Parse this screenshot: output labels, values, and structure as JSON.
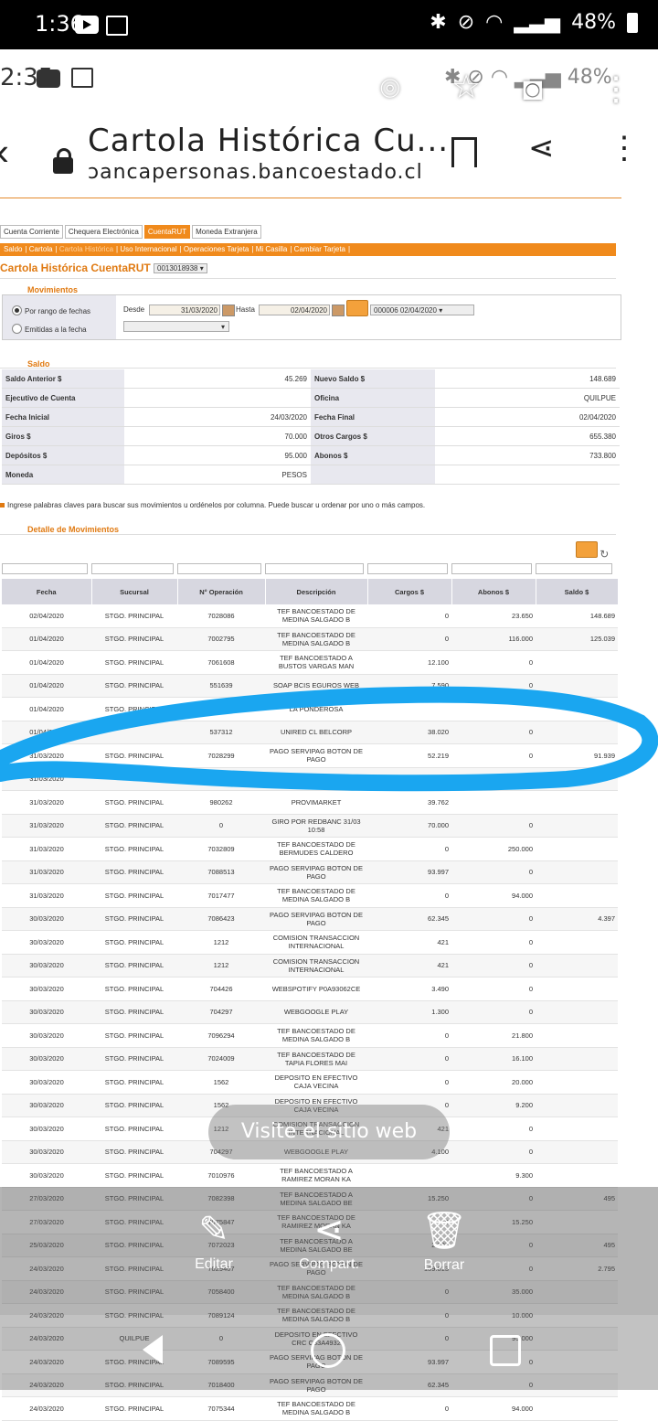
{
  "status_bar": {
    "time": "1:36",
    "battery": "48%"
  },
  "inner_status": {
    "time": "2:35",
    "battery": "48%"
  },
  "browser": {
    "title": "Cartola Histórica Cu...",
    "url": "bancapersonas.bancoestado.cl",
    "url_shown": "ɔancapersonas.bancoestado.cl"
  },
  "tabs": [
    "Cuenta Corriente",
    "Chequera Electrónica",
    "CuentaRUT",
    "Moneda Extranjera"
  ],
  "subnav": [
    "Saldo",
    "Cartola",
    "Cartola Histórica",
    "Uso Internacional",
    "Operaciones Tarjeta",
    "Mi Casilla",
    "Cambiar Tarjeta"
  ],
  "page_title": "Cartola Histórica CuentaRUT N°",
  "account_number": "0013018938",
  "movimientos": {
    "section": "Movimientos",
    "option_range": "Por rango de fechas",
    "option_emitidas": "Emitidas a la fecha",
    "desde_label": "Desde",
    "desde_value": "31/03/2020",
    "hasta_label": "Hasta",
    "hasta_value": "02/04/2020",
    "statement_select": "000006 02/04/2020"
  },
  "saldo": {
    "section": "Saldo",
    "rows": [
      {
        "l1": "Saldo Anterior $",
        "v1": "45.269",
        "l2": "Nuevo Saldo $",
        "v2": "148.689"
      },
      {
        "l1": "Ejecutivo de Cuenta",
        "v1": "",
        "l2": "Oficina",
        "v2": "QUILPUE"
      },
      {
        "l1": "Fecha Inicial",
        "v1": "24/03/2020",
        "l2": "Fecha Final",
        "v2": "02/04/2020"
      },
      {
        "l1": "Giros $",
        "v1": "70.000",
        "l2": "Otros Cargos $",
        "v2": "655.380"
      },
      {
        "l1": "Depósitos $",
        "v1": "95.000",
        "l2": "Abonos $",
        "v2": "733.800"
      },
      {
        "l1": "Moneda",
        "v1": "PESOS",
        "l2": "",
        "v2": ""
      }
    ]
  },
  "hint": "Ingrese palabras claves para buscar sus movimientos u ordénelos por columna. Puede buscar u ordenar por uno o más campos.",
  "detalle": {
    "section": "Detalle de Movimientos",
    "headers": [
      "Fecha",
      "Sucursal",
      "N° Operación",
      "Descripción",
      "Cargos $",
      "Abonos $",
      "Saldo $"
    ],
    "rows": [
      [
        "02/04/2020",
        "STGO. PRINCIPAL",
        "7028086",
        "TEF BANCOESTADO DE MEDINA SALGADO B",
        "0",
        "23.650",
        "148.689"
      ],
      [
        "01/04/2020",
        "STGO. PRINCIPAL",
        "7002795",
        "TEF BANCOESTADO DE MEDINA SALGADO B",
        "0",
        "116.000",
        "125.039"
      ],
      [
        "01/04/2020",
        "STGO. PRINCIPAL",
        "7061608",
        "TEF BANCOESTADO A BUSTOS VARGAS MAN",
        "12.100",
        "0",
        ""
      ],
      [
        "01/04/2020",
        "STGO. PRINCIPAL",
        "551639",
        "SOAP BCIS EGUROS WEB",
        "7.590",
        "0",
        ""
      ],
      [
        "01/04/2020",
        "STGO. PRINCIPAL",
        "",
        "LA PONDEROSA",
        "",
        "",
        ""
      ],
      [
        "01/04/2020",
        "",
        "537312",
        "UNIRED CL BELCORP",
        "38.020",
        "0",
        ""
      ],
      [
        "31/03/2020",
        "STGO. PRINCIPAL",
        "7028299",
        "PAGO SERVIPAG BOTON DE PAGO",
        "52.219",
        "0",
        "91.939"
      ],
      [
        "31/03/2020",
        "",
        "",
        "",
        "880",
        "0",
        ""
      ],
      [
        "31/03/2020",
        "STGO. PRINCIPAL",
        "980262",
        "PROVIMARKET",
        "39.762",
        "",
        ""
      ],
      [
        "31/03/2020",
        "STGO. PRINCIPAL",
        "0",
        "GIRO POR REDBANC 31/03 10:58",
        "70.000",
        "0",
        ""
      ],
      [
        "31/03/2020",
        "STGO. PRINCIPAL",
        "7032809",
        "TEF BANCOESTADO DE BERMUDES CALDERO",
        "0",
        "250.000",
        ""
      ],
      [
        "31/03/2020",
        "STGO. PRINCIPAL",
        "7088513",
        "PAGO SERVIPAG BOTON DE PAGO",
        "93.997",
        "0",
        ""
      ],
      [
        "31/03/2020",
        "STGO. PRINCIPAL",
        "7017477",
        "TEF BANCOESTADO DE MEDINA SALGADO B",
        "0",
        "94.000",
        ""
      ],
      [
        "30/03/2020",
        "STGO. PRINCIPAL",
        "7086423",
        "PAGO SERVIPAG BOTON DE PAGO",
        "62.345",
        "0",
        "4.397"
      ],
      [
        "30/03/2020",
        "STGO. PRINCIPAL",
        "1212",
        "COMISION TRANSACCION INTERNACIONAL",
        "421",
        "0",
        ""
      ],
      [
        "30/03/2020",
        "STGO. PRINCIPAL",
        "1212",
        "COMISION TRANSACCION INTERNACIONAL",
        "421",
        "0",
        ""
      ],
      [
        "30/03/2020",
        "STGO. PRINCIPAL",
        "704426",
        "WEBSPOTIFY P0A93062CE",
        "3.490",
        "0",
        ""
      ],
      [
        "30/03/2020",
        "STGO. PRINCIPAL",
        "704297",
        "WEBGOOGLE PLAY",
        "1.300",
        "0",
        ""
      ],
      [
        "30/03/2020",
        "STGO. PRINCIPAL",
        "7096294",
        "TEF BANCOESTADO DE MEDINA SALGADO B",
        "0",
        "21.800",
        ""
      ],
      [
        "30/03/2020",
        "STGO. PRINCIPAL",
        "7024009",
        "TEF BANCOESTADO DE TAPIA FLORES MAI",
        "0",
        "16.100",
        ""
      ],
      [
        "30/03/2020",
        "STGO. PRINCIPAL",
        "1562",
        "DEPOSITO EN EFECTIVO CAJA VECINA",
        "0",
        "20.000",
        ""
      ],
      [
        "30/03/2020",
        "STGO. PRINCIPAL",
        "1562",
        "DEPOSITO EN EFECTIVO CAJA VECINA",
        "0",
        "9.200",
        ""
      ],
      [
        "30/03/2020",
        "STGO. PRINCIPAL",
        "1212",
        "COMISION TRANSACCION INTERNACIONAL",
        "421",
        "0",
        ""
      ],
      [
        "30/03/2020",
        "STGO. PRINCIPAL",
        "704297",
        "WEBGOOGLE PLAY",
        "4.100",
        "0",
        ""
      ],
      [
        "30/03/2020",
        "STGO. PRINCIPAL",
        "7010976",
        "TEF BANCOESTADO A RAMIREZ MORAN KA",
        "",
        "9.300",
        ""
      ],
      [
        "27/03/2020",
        "STGO. PRINCIPAL",
        "7082398",
        "TEF BANCOESTADO A MEDINA SALGADO BE",
        "15.250",
        "0",
        "495"
      ],
      [
        "27/03/2020",
        "STGO. PRINCIPAL",
        "7075847",
        "TEF BANCOESTADO DE RAMIREZ MORAN KA",
        "0",
        "15.250",
        ""
      ],
      [
        "25/03/2020",
        "STGO. PRINCIPAL",
        "7072023",
        "TEF BANCOESTADO A MEDINA SALGADO BE",
        "2.300",
        "0",
        "495"
      ],
      [
        "24/03/2020",
        "STGO. PRINCIPAL",
        "7029407",
        "PAGO SERVIPAG BOTON DE PAGO",
        "139.813",
        "0",
        "2.795"
      ],
      [
        "24/03/2020",
        "STGO. PRINCIPAL",
        "7058400",
        "TEF BANCOESTADO DE MEDINA SALGADO B",
        "0",
        "35.000",
        ""
      ],
      [
        "24/03/2020",
        "STGO. PRINCIPAL",
        "7089124",
        "TEF BANCOESTADO DE MEDINA SALGADO B",
        "0",
        "10.000",
        ""
      ],
      [
        "24/03/2020",
        "QUILPUE",
        "0",
        "DEPOSITO EN EFECTIVO CRC C33A4932",
        "0",
        "95.000",
        ""
      ],
      [
        "24/03/2020",
        "STGO. PRINCIPAL",
        "7089595",
        "PAGO SERVIPAG BOTON DE PAGO",
        "93.997",
        "0",
        ""
      ],
      [
        "24/03/2020",
        "STGO. PRINCIPAL",
        "7018400",
        "PAGO SERVIPAG BOTON DE PAGO",
        "62.345",
        "0",
        ""
      ],
      [
        "24/03/2020",
        "STGO. PRINCIPAL",
        "7075344",
        "TEF BANCOESTADO DE MEDINA SALGADO B",
        "0",
        "94.000",
        ""
      ]
    ]
  },
  "overlay": {
    "visit_site": "Visite el sitio web",
    "actions": [
      "Editar",
      "Compart.",
      "Borrar"
    ]
  }
}
